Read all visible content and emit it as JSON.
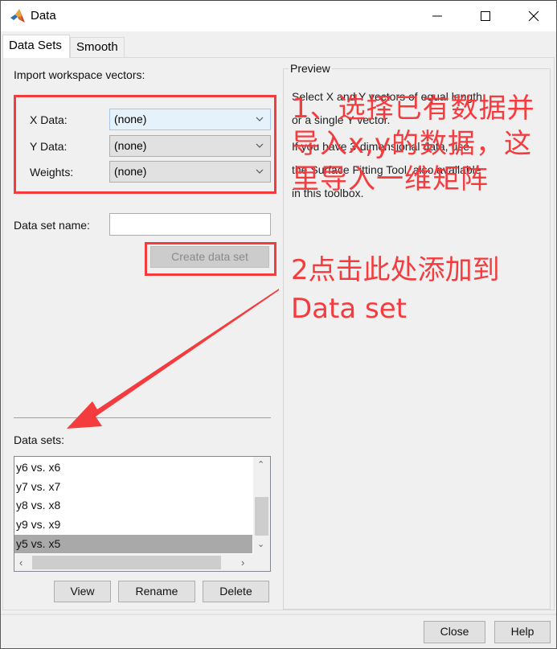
{
  "window": {
    "title": "Data",
    "minimize_label": "minimize",
    "maximize_label": "maximize",
    "close_label": "close"
  },
  "tabs": [
    {
      "label": "Data Sets",
      "active": true
    },
    {
      "label": "Smooth",
      "active": false
    }
  ],
  "import": {
    "section_label": "Import workspace vectors:",
    "x_data": {
      "label": "X Data:",
      "value": "(none)"
    },
    "y_data": {
      "label": "Y Data:",
      "value": "(none)"
    },
    "weights": {
      "label": "Weights:",
      "value": "(none)"
    }
  },
  "dataset_name": {
    "label": "Data set name:",
    "value": ""
  },
  "create_button": {
    "label": "Create data set",
    "enabled": false
  },
  "datasets": {
    "label": "Data sets:",
    "items": [
      {
        "label": "y6 vs. x6",
        "selected": false
      },
      {
        "label": "y7 vs. x7",
        "selected": false
      },
      {
        "label": "y8 vs. x8",
        "selected": false
      },
      {
        "label": "y9 vs. x9",
        "selected": false
      },
      {
        "label": "y5 vs. x5",
        "selected": true
      }
    ],
    "buttons": {
      "view": "View",
      "rename": "Rename",
      "delete": "Delete"
    }
  },
  "preview": {
    "title": "Preview",
    "lines": [
      "Select X and Y vectors of equal length",
      "or a single Y vector.",
      "If you have 3-dimensional data, use",
      "the Surface Fitting Tool, also available",
      "in this toolbox."
    ]
  },
  "annotations": {
    "note1_lines": [
      "1、选择已有数据并",
      "导入x,y的数据，这",
      "里导入一维矩阵"
    ],
    "note2_lines": [
      "2点击此处添加到",
      "Data set"
    ],
    "color": "#f43b3e"
  },
  "footer": {
    "close": "Close",
    "help": "Help"
  }
}
